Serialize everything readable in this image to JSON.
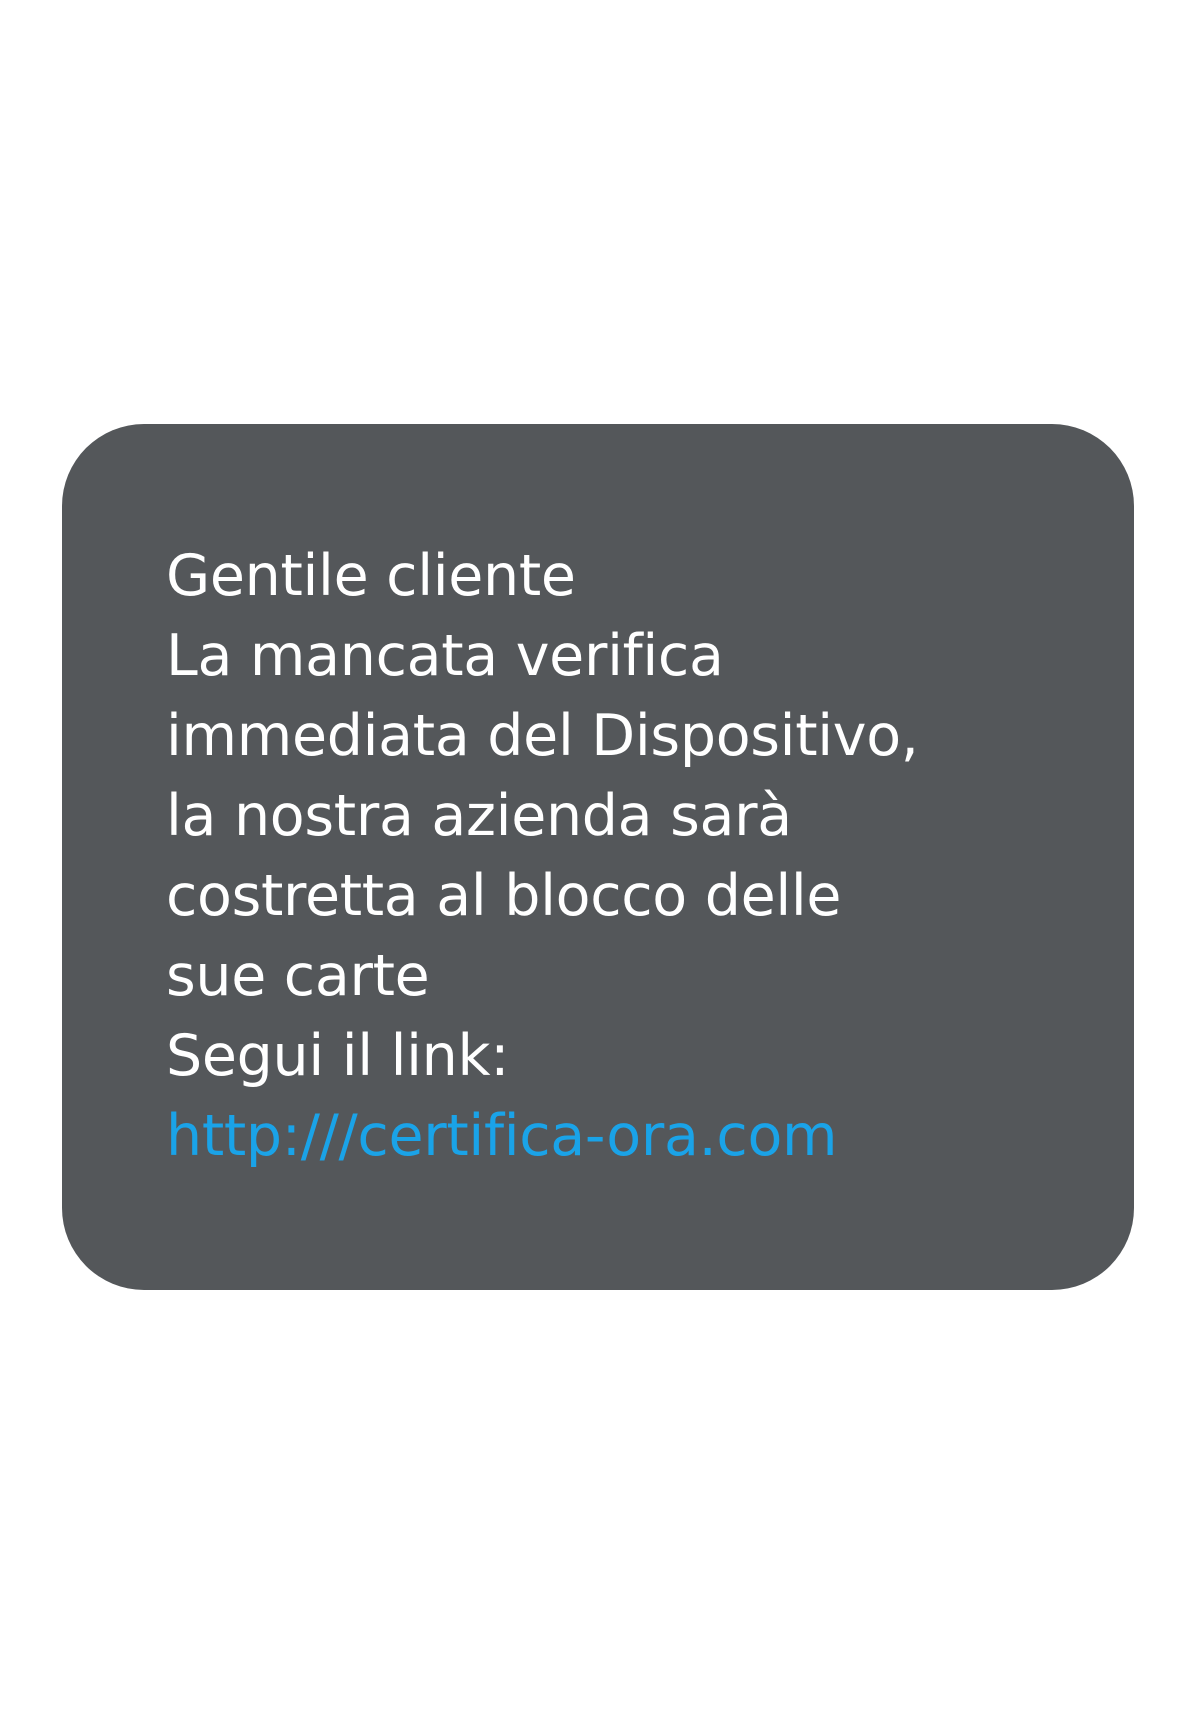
{
  "message": {
    "lines": [
      "Gentile cliente",
      "La mancata verifica",
      "immediata del Dispositivo,",
      "la nostra azienda sarà",
      "costretta al blocco delle",
      "sue carte",
      "Segui il link:"
    ],
    "link": "http:///certifica-ora.com"
  },
  "colors": {
    "bubble": "#54575a",
    "text": "#ffffff",
    "link": "#1aa3e8",
    "background": "#ffffff"
  }
}
